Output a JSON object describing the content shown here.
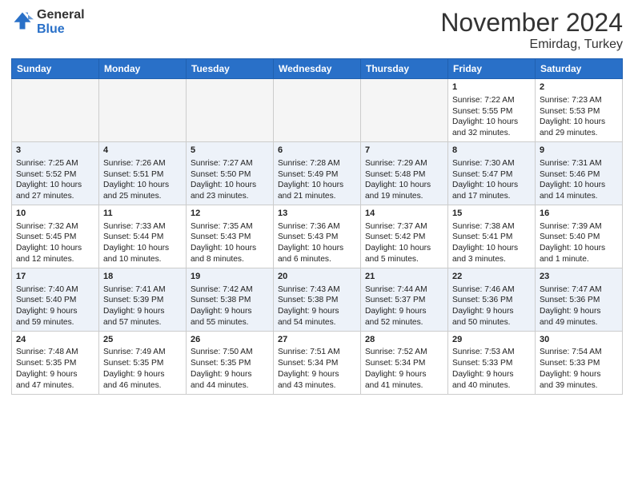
{
  "header": {
    "logo_general": "General",
    "logo_blue": "Blue",
    "month": "November 2024",
    "location": "Emirdag, Turkey"
  },
  "weekdays": [
    "Sunday",
    "Monday",
    "Tuesday",
    "Wednesday",
    "Thursday",
    "Friday",
    "Saturday"
  ],
  "weeks": [
    [
      {
        "day": "",
        "info": ""
      },
      {
        "day": "",
        "info": ""
      },
      {
        "day": "",
        "info": ""
      },
      {
        "day": "",
        "info": ""
      },
      {
        "day": "",
        "info": ""
      },
      {
        "day": "1",
        "info": "Sunrise: 7:22 AM\nSunset: 5:55 PM\nDaylight: 10 hours\nand 32 minutes."
      },
      {
        "day": "2",
        "info": "Sunrise: 7:23 AM\nSunset: 5:53 PM\nDaylight: 10 hours\nand 29 minutes."
      }
    ],
    [
      {
        "day": "3",
        "info": "Sunrise: 7:25 AM\nSunset: 5:52 PM\nDaylight: 10 hours\nand 27 minutes."
      },
      {
        "day": "4",
        "info": "Sunrise: 7:26 AM\nSunset: 5:51 PM\nDaylight: 10 hours\nand 25 minutes."
      },
      {
        "day": "5",
        "info": "Sunrise: 7:27 AM\nSunset: 5:50 PM\nDaylight: 10 hours\nand 23 minutes."
      },
      {
        "day": "6",
        "info": "Sunrise: 7:28 AM\nSunset: 5:49 PM\nDaylight: 10 hours\nand 21 minutes."
      },
      {
        "day": "7",
        "info": "Sunrise: 7:29 AM\nSunset: 5:48 PM\nDaylight: 10 hours\nand 19 minutes."
      },
      {
        "day": "8",
        "info": "Sunrise: 7:30 AM\nSunset: 5:47 PM\nDaylight: 10 hours\nand 17 minutes."
      },
      {
        "day": "9",
        "info": "Sunrise: 7:31 AM\nSunset: 5:46 PM\nDaylight: 10 hours\nand 14 minutes."
      }
    ],
    [
      {
        "day": "10",
        "info": "Sunrise: 7:32 AM\nSunset: 5:45 PM\nDaylight: 10 hours\nand 12 minutes."
      },
      {
        "day": "11",
        "info": "Sunrise: 7:33 AM\nSunset: 5:44 PM\nDaylight: 10 hours\nand 10 minutes."
      },
      {
        "day": "12",
        "info": "Sunrise: 7:35 AM\nSunset: 5:43 PM\nDaylight: 10 hours\nand 8 minutes."
      },
      {
        "day": "13",
        "info": "Sunrise: 7:36 AM\nSunset: 5:43 PM\nDaylight: 10 hours\nand 6 minutes."
      },
      {
        "day": "14",
        "info": "Sunrise: 7:37 AM\nSunset: 5:42 PM\nDaylight: 10 hours\nand 5 minutes."
      },
      {
        "day": "15",
        "info": "Sunrise: 7:38 AM\nSunset: 5:41 PM\nDaylight: 10 hours\nand 3 minutes."
      },
      {
        "day": "16",
        "info": "Sunrise: 7:39 AM\nSunset: 5:40 PM\nDaylight: 10 hours\nand 1 minute."
      }
    ],
    [
      {
        "day": "17",
        "info": "Sunrise: 7:40 AM\nSunset: 5:40 PM\nDaylight: 9 hours\nand 59 minutes."
      },
      {
        "day": "18",
        "info": "Sunrise: 7:41 AM\nSunset: 5:39 PM\nDaylight: 9 hours\nand 57 minutes."
      },
      {
        "day": "19",
        "info": "Sunrise: 7:42 AM\nSunset: 5:38 PM\nDaylight: 9 hours\nand 55 minutes."
      },
      {
        "day": "20",
        "info": "Sunrise: 7:43 AM\nSunset: 5:38 PM\nDaylight: 9 hours\nand 54 minutes."
      },
      {
        "day": "21",
        "info": "Sunrise: 7:44 AM\nSunset: 5:37 PM\nDaylight: 9 hours\nand 52 minutes."
      },
      {
        "day": "22",
        "info": "Sunrise: 7:46 AM\nSunset: 5:36 PM\nDaylight: 9 hours\nand 50 minutes."
      },
      {
        "day": "23",
        "info": "Sunrise: 7:47 AM\nSunset: 5:36 PM\nDaylight: 9 hours\nand 49 minutes."
      }
    ],
    [
      {
        "day": "24",
        "info": "Sunrise: 7:48 AM\nSunset: 5:35 PM\nDaylight: 9 hours\nand 47 minutes."
      },
      {
        "day": "25",
        "info": "Sunrise: 7:49 AM\nSunset: 5:35 PM\nDaylight: 9 hours\nand 46 minutes."
      },
      {
        "day": "26",
        "info": "Sunrise: 7:50 AM\nSunset: 5:35 PM\nDaylight: 9 hours\nand 44 minutes."
      },
      {
        "day": "27",
        "info": "Sunrise: 7:51 AM\nSunset: 5:34 PM\nDaylight: 9 hours\nand 43 minutes."
      },
      {
        "day": "28",
        "info": "Sunrise: 7:52 AM\nSunset: 5:34 PM\nDaylight: 9 hours\nand 41 minutes."
      },
      {
        "day": "29",
        "info": "Sunrise: 7:53 AM\nSunset: 5:33 PM\nDaylight: 9 hours\nand 40 minutes."
      },
      {
        "day": "30",
        "info": "Sunrise: 7:54 AM\nSunset: 5:33 PM\nDaylight: 9 hours\nand 39 minutes."
      }
    ]
  ]
}
